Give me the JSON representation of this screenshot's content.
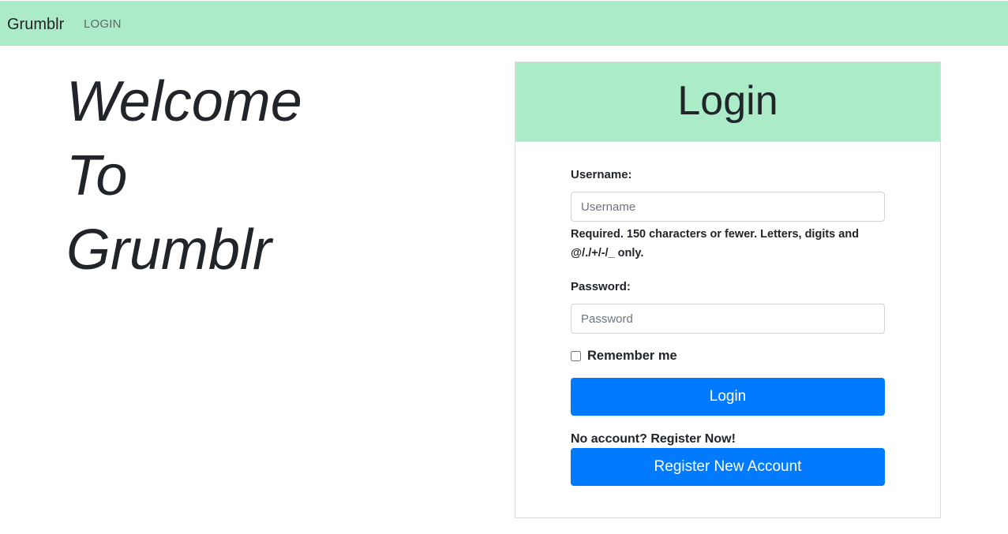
{
  "navbar": {
    "brand": "Grumblr",
    "login_link": "LOGIN",
    "background": "#abebc8"
  },
  "hero": {
    "line1": "Welcome",
    "line2": "To",
    "line3": "Grumblr"
  },
  "login_card": {
    "title": "Login",
    "username": {
      "label": "Username:",
      "placeholder": "Username",
      "value": "",
      "help": "Required. 150 characters or fewer. Letters, digits and @/./+/-/_ only."
    },
    "password": {
      "label": "Password:",
      "placeholder": "Password",
      "value": ""
    },
    "remember_me": {
      "label": "Remember me",
      "checked": false
    },
    "login_button": "Login",
    "no_account_text": "No account? Register Now!",
    "register_button": "Register New Account",
    "button_color": "#007bff"
  }
}
